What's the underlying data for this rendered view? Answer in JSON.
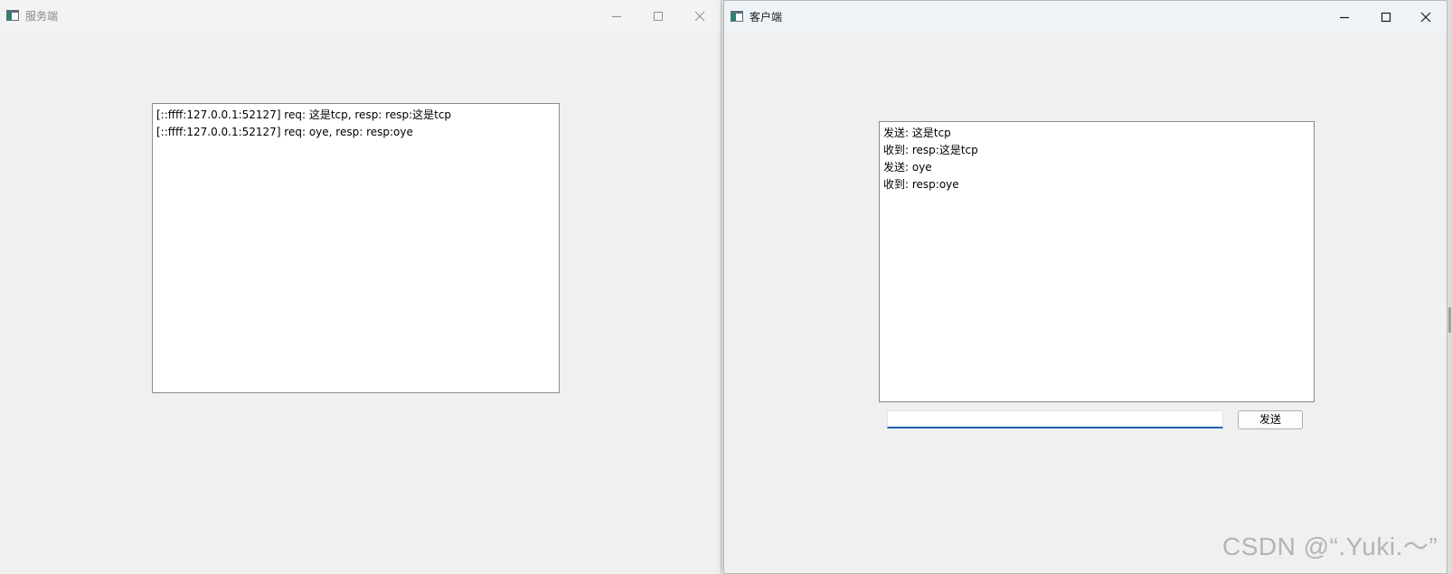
{
  "server_window": {
    "title": "服务端",
    "icon": "app-window-icon",
    "controls": [
      "minimize-icon",
      "maximize-icon",
      "close-icon"
    ],
    "log": [
      "[::ffff:127.0.0.1:52127] req: 这是tcp, resp: resp:这是tcp",
      "[::ffff:127.0.0.1:52127] req: oye, resp: resp:oye"
    ]
  },
  "client_window": {
    "title": "客户端",
    "icon": "app-window-icon",
    "controls": [
      "minimize-icon",
      "maximize-icon",
      "close-icon"
    ],
    "log": [
      "发送: 这是tcp",
      "收到: resp:这是tcp",
      "发送: oye",
      "收到: resp:oye"
    ],
    "input": {
      "value": "",
      "placeholder": ""
    },
    "send_label": "发送"
  },
  "watermark": "CSDN @“.Yuki.～”",
  "colors": {
    "window_bg": "#f0f0f0",
    "input_focus_accent": "#1e62b8",
    "client_titlebar": "#eef3f7"
  }
}
